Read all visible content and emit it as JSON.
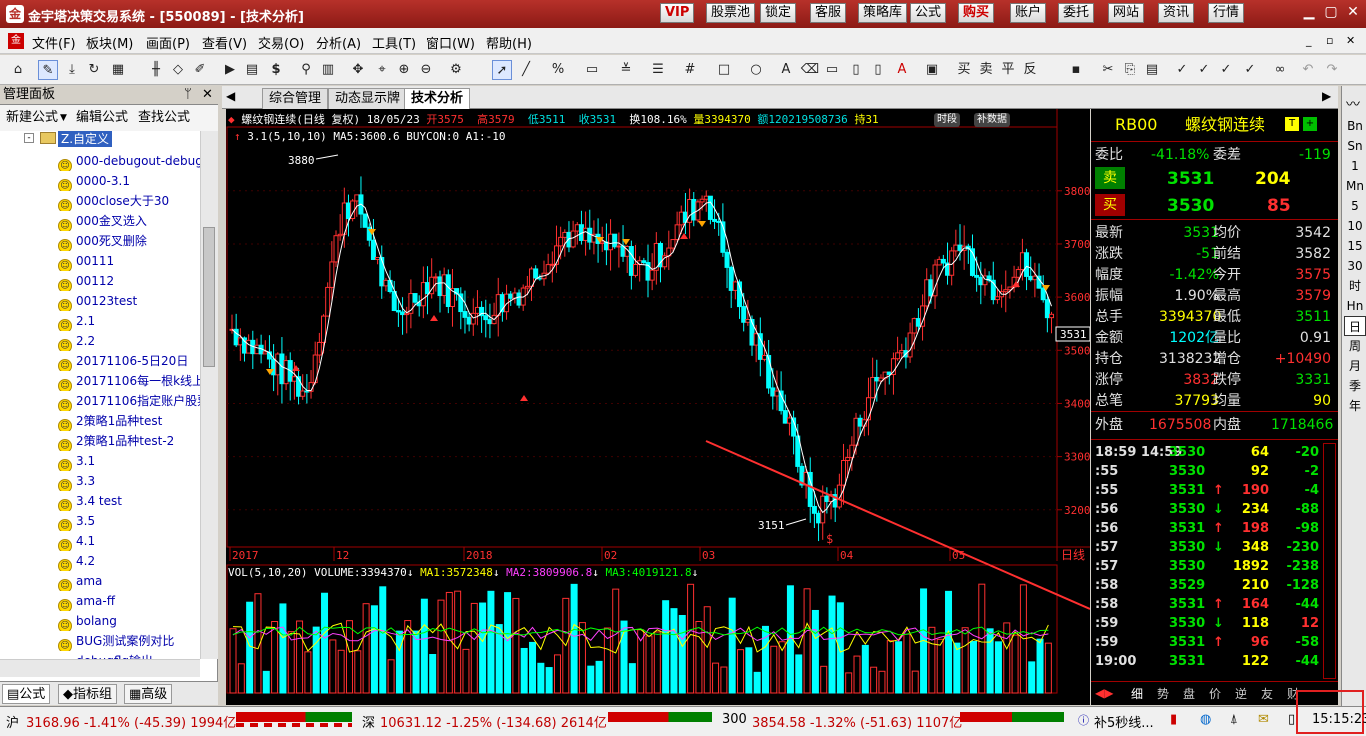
{
  "window": {
    "title": "金宇塔决策交易系统 - [550089] - [技术分析]"
  },
  "top_buttons": [
    "VIP",
    "股票池",
    "锁定",
    "客服",
    "策略库",
    "公式",
    "购买",
    "账户",
    "委托",
    "网站",
    "资讯",
    "行情"
  ],
  "menu": [
    "文件(F)",
    "板块(M)",
    "画面(P)",
    "查看(V)",
    "交易(O)",
    "分析(A)",
    "工具(T)",
    "窗口(W)",
    "帮助(H)"
  ],
  "left_panel": {
    "title": "管理面板",
    "actions": [
      "新建公式",
      "编辑公式",
      "查找公式"
    ],
    "root": "Z.自定义",
    "items": [
      "000-debugout-debug",
      "0000-3.1",
      "000close大于30",
      "000金叉选入",
      "000死叉删除",
      "00111",
      "00112",
      "00123test",
      "2.1",
      "2.2",
      "20171106-5日20日",
      "20171106每一根k线上",
      "20171106指定账户股票",
      "2策略1品种test",
      "2策略1品种test-2",
      "3.1",
      "3.3",
      "3.4 test",
      "3.5",
      "4.1",
      "4.2",
      "ama",
      "ama-ff",
      "bolang",
      "BUG测试案例对比",
      "debugflg输出"
    ],
    "tabs": [
      "公式",
      "指标组",
      "高级"
    ]
  },
  "chart_tabs": [
    "综合管理",
    "动态显示牌",
    "技术分析"
  ],
  "chart": {
    "header": "螺纹钢连续(日线 复权) 18/05/23",
    "open": "开3575",
    "high": "高3579",
    "low": "低3511",
    "close": "收3531",
    "turnover": "换108.16%",
    "volume": "量3394370",
    "amount": "额120219508736",
    "position": "持31",
    "badge1": "时段",
    "badge2": "补数据",
    "indicator_line": "3.1(5,10,10)  MA5:3600.6  BUYCON:0  A1:-10",
    "max_label": "3880",
    "min_label": "3151",
    "price_tag": "3531",
    "vol_header": "VOL(5,10,20) VOLUME:3394370",
    "ma1": "MA1:3572348",
    "ma2": "MA2:3809906.8",
    "ma3": "MA3:4019121.8",
    "period": "日线"
  },
  "chart_data": {
    "type": "candlestick",
    "y_ticks": [
      3200,
      3300,
      3400,
      3500,
      3600,
      3700,
      3800
    ],
    "ylim": [
      3130,
      3920
    ],
    "x_labels": [
      "2017",
      "12",
      "2018",
      "02",
      "03",
      "04",
      "05"
    ]
  },
  "quote": {
    "code": "RB00",
    "name": "螺纹钢连续",
    "weibi_l": "委比",
    "weibi": "-41.18%",
    "weicha_l": "委差",
    "weicha": "-119",
    "sell_l": "卖",
    "sell_price": "3531",
    "sell_vol": "204",
    "buy_l": "买",
    "buy_price": "3530",
    "buy_vol": "85",
    "rows": [
      [
        "最新",
        "3531",
        "均价",
        "3542"
      ],
      [
        "涨跌",
        "-51",
        "前结",
        "3582"
      ],
      [
        "幅度",
        "-1.42%",
        "今开",
        "3575"
      ],
      [
        "振幅",
        "1.90%",
        "最高",
        "3579"
      ],
      [
        "总手",
        "3394370",
        "最低",
        "3511"
      ],
      [
        "金额",
        "1202亿",
        "量比",
        "0.91"
      ],
      [
        "持仓",
        "3138232",
        "增仓",
        "+10490"
      ],
      [
        "涨停",
        "3832",
        "跌停",
        "3331"
      ],
      [
        "总笔",
        "37793",
        "均量",
        "90"
      ]
    ],
    "waipan_l": "外盘",
    "waipan": "1675508",
    "neipan_l": "内盘",
    "neipan": "1718466",
    "ticks": [
      [
        "18:59 14:59",
        "3530",
        "",
        "64",
        "-20"
      ],
      [
        ":55",
        "3530",
        "",
        "92",
        "-2"
      ],
      [
        ":55",
        "3531",
        "↑",
        "190",
        "-4"
      ],
      [
        ":56",
        "3530",
        "↓",
        "234",
        "-88"
      ],
      [
        ":56",
        "3531",
        "↑",
        "198",
        "-98"
      ],
      [
        ":57",
        "3530",
        "↓",
        "348",
        "-230"
      ],
      [
        ":57",
        "3530",
        "",
        "1892",
        "-238"
      ],
      [
        ":58",
        "3529",
        "",
        "210",
        "-128"
      ],
      [
        ":58",
        "3531",
        "↑",
        "164",
        "-44"
      ],
      [
        ":59",
        "3530",
        "↓",
        "118",
        "12"
      ],
      [
        ":59",
        "3531",
        "↑",
        "96",
        "-58"
      ],
      [
        "19:00",
        "3531",
        "",
        "122",
        "-44"
      ]
    ],
    "bottom_tabs": [
      "细",
      "势",
      "盘",
      "价",
      "逆",
      "友",
      "财"
    ]
  },
  "right_strip": [
    "Bn",
    "Sn",
    "1",
    "Mn",
    "5",
    "10",
    "15",
    "30",
    "时",
    "Hn",
    "日",
    "周",
    "月",
    "季",
    "年"
  ],
  "status": {
    "sh_label": "沪",
    "sh": "3168.96 -1.41% (-45.39) 1994亿",
    "sz_label": "深",
    "sz": "10631.12 -1.25% (-134.68) 2614亿",
    "c300_label": "300",
    "c300": "3854.58 -1.32% (-51.63) 1107亿",
    "notice": "补5秒线...",
    "time": "15:15:23"
  }
}
